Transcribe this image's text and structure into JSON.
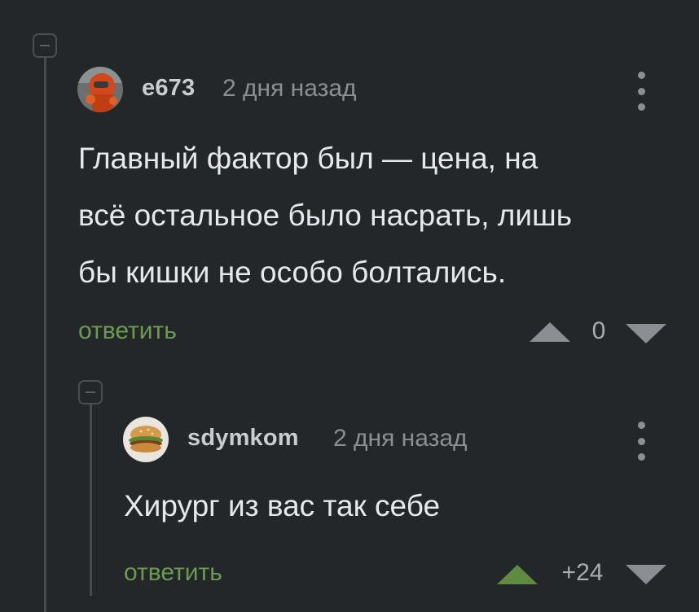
{
  "comments": [
    {
      "username": "e673",
      "time": "2 дня назад",
      "text_lines": [
        "Главный фактор был — цена, на",
        "всё остальное было насрать, лишь",
        "бы кишки не особо болтались."
      ],
      "reply_label": "ответить",
      "rating": "0",
      "avatar_icon": "orange-astronaut-avatar-icon"
    },
    {
      "username": "sdymkom",
      "time": "2 дня назад",
      "text_lines": [
        "Хирург из вас так себе"
      ],
      "reply_label": "ответить",
      "rating": "+24",
      "avatar_icon": "burger-avatar-icon"
    }
  ],
  "colors": {
    "background": "#24272a",
    "reply_link": "#6c9b50",
    "upvoted": "#5e8b3f",
    "vote_neutral": "#8b8f94"
  }
}
